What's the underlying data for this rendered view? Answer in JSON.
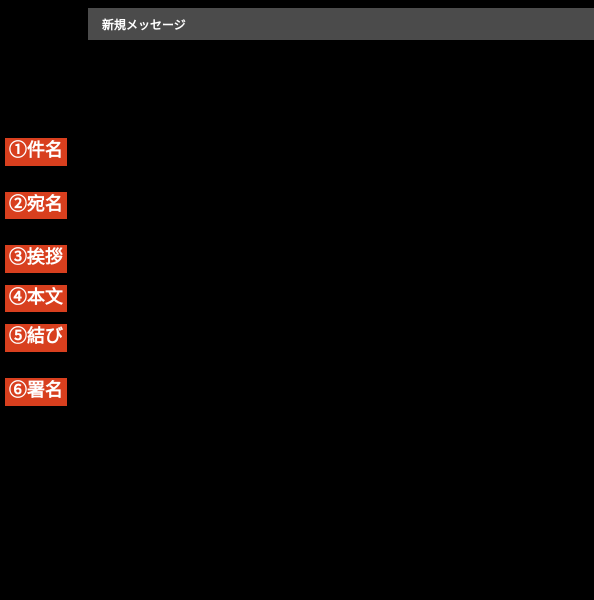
{
  "header": {
    "title": "新規メッセージ"
  },
  "labels": [
    {
      "text": "①件名"
    },
    {
      "text": "②宛名"
    },
    {
      "text": "③挨拶"
    },
    {
      "text": "④本文"
    },
    {
      "text": "⑤結び"
    },
    {
      "text": "⑥署名"
    }
  ]
}
